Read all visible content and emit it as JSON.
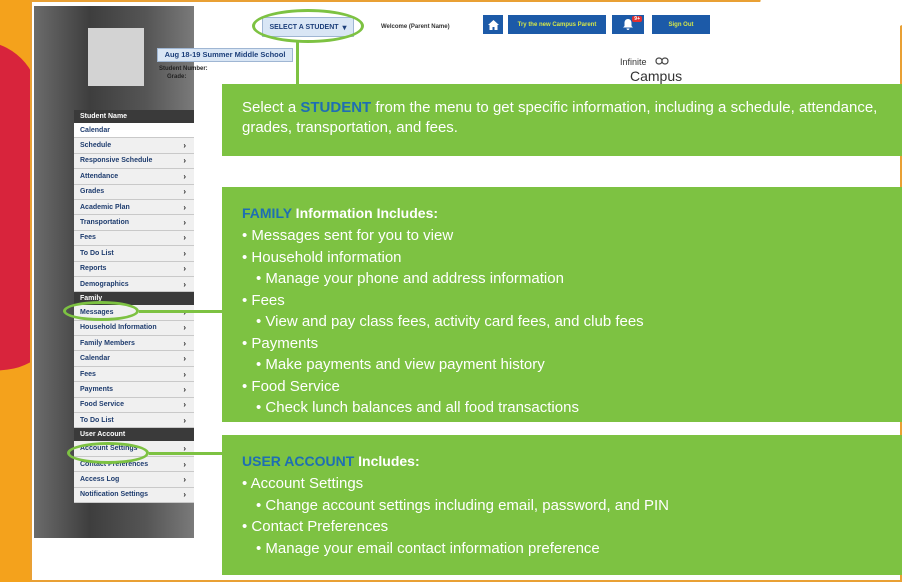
{
  "header": {
    "select_student": "SELECT A STUDENT",
    "select_student_caret": "▾",
    "welcome": "Welcome (Parent Name)",
    "home_icon": "home-icon",
    "try_campus_parent": "Try the new Campus Parent",
    "notifications_icon": "bell-icon",
    "notifications_count": "9+",
    "sign_out": "Sign Out",
    "logo_top": "Infinite",
    "logo_bottom": "Campus"
  },
  "student": {
    "school": "Aug 18-19 Summer Middle School",
    "number_label": "Student Number:",
    "grade_label": "Grade:"
  },
  "sidebar": {
    "student_header": "Student Name",
    "student_items": [
      {
        "label": "Calendar",
        "chevron": false
      },
      {
        "label": "Schedule",
        "chevron": true
      },
      {
        "label": "Responsive Schedule",
        "chevron": true
      },
      {
        "label": "Attendance",
        "chevron": true
      },
      {
        "label": "Grades",
        "chevron": true
      },
      {
        "label": "Academic Plan",
        "chevron": true
      },
      {
        "label": "Transportation",
        "chevron": true
      },
      {
        "label": "Fees",
        "chevron": true
      },
      {
        "label": "To Do List",
        "chevron": true
      },
      {
        "label": "Reports",
        "chevron": true
      },
      {
        "label": "Demographics",
        "chevron": true
      }
    ],
    "family_header": "Family",
    "family_items": [
      {
        "label": "Messages",
        "chevron": true
      },
      {
        "label": "Household Information",
        "chevron": true
      },
      {
        "label": "Family Members",
        "chevron": true
      },
      {
        "label": "Calendar",
        "chevron": true
      },
      {
        "label": "Fees",
        "chevron": true
      },
      {
        "label": "Payments",
        "chevron": true
      },
      {
        "label": "Food Service",
        "chevron": true
      },
      {
        "label": "To Do List",
        "chevron": true
      }
    ],
    "account_header": "User Account",
    "account_items": [
      {
        "label": "Account Settings",
        "chevron": true
      },
      {
        "label": "Contact Preferences",
        "chevron": true
      },
      {
        "label": "Access Log",
        "chevron": true
      },
      {
        "label": "Notification Settings",
        "chevron": true
      }
    ]
  },
  "box_student": {
    "pre": "Select a ",
    "highlight": "STUDENT",
    "post": " from the menu to get specific information, including a schedule, attendance, grades, transportation, and fees."
  },
  "box_family": {
    "highlight": "FAMILY",
    "title_rest": " Information Includes:",
    "lines": [
      {
        "text": "• Messages sent for you to view",
        "sub": false
      },
      {
        "text": "• Household information",
        "sub": false
      },
      {
        "text": "• Manage your phone and address information",
        "sub": true
      },
      {
        "text": "• Fees",
        "sub": false
      },
      {
        "text": "• View and pay class fees, activity card fees, and club fees",
        "sub": true
      },
      {
        "text": "• Payments",
        "sub": false
      },
      {
        "text": "• Make payments and view payment history",
        "sub": true
      },
      {
        "text": "• Food Service",
        "sub": false
      },
      {
        "text": "• Check lunch balances and all food transactions",
        "sub": true
      }
    ]
  },
  "box_account": {
    "highlight": "USER ACCOUNT",
    "title_rest": " Includes:",
    "lines": [
      {
        "text": "• Account Settings",
        "sub": false
      },
      {
        "text": "• Change account settings including email, password, and PIN",
        "sub": true
      },
      {
        "text": "• Contact Preferences",
        "sub": false
      },
      {
        "text": "• Manage your email contact information preference",
        "sub": true
      }
    ]
  },
  "colors": {
    "accent_green": "#7dc242",
    "highlight_blue": "#1e6eb3",
    "button_blue": "#1c5aa8",
    "background_orange": "#f4a21c"
  }
}
